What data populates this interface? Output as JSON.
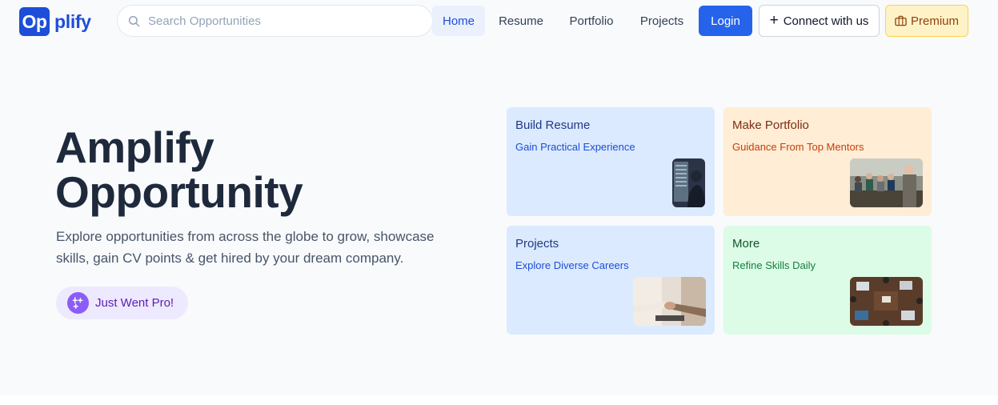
{
  "header": {
    "logo": {
      "box_text": "Op",
      "rest_text": "plify"
    },
    "search": {
      "placeholder": "Search Opportunities",
      "value": ""
    },
    "nav": [
      {
        "label": "Home",
        "active": true
      },
      {
        "label": "Resume",
        "active": false
      },
      {
        "label": "Portfolio",
        "active": false
      },
      {
        "label": "Projects",
        "active": false
      }
    ],
    "login_label": "Login",
    "connect_label": "Connect with us",
    "premium_label": "Premium"
  },
  "hero": {
    "title_line1": "Amplify",
    "title_line2": "Opportunity",
    "description": "Explore opportunities from across the globe to grow, showcase skills, gain CV points & get hired by your dream company.",
    "pro_badge_label": "Just Went Pro!"
  },
  "cards": [
    {
      "title": "Build Resume",
      "subtitle": "Gain Practical Experience",
      "image": "developer-at-monitors-photo"
    },
    {
      "title": "Make Portfolio",
      "subtitle": "Guidance From Top Mentors",
      "image": "team-meeting-photo"
    },
    {
      "title": "Projects",
      "subtitle": "Explore Diverse Careers",
      "image": "handshake-photo"
    },
    {
      "title": "More",
      "subtitle": "Refine Skills Daily",
      "image": "desk-with-laptops-photo"
    }
  ],
  "colors": {
    "brand": "#1d4ed8",
    "login_bg": "#2563eb",
    "premium_bg": "#fef3c7",
    "hero_bg": "#f8fafc",
    "card_blue": "#dbeafe",
    "card_orange": "#ffedd5",
    "card_green": "#dcfce7",
    "badge_bg": "#ede9fe"
  },
  "icons": [
    "search-icon",
    "plus-icon",
    "briefcase-icon",
    "sparkle-icon"
  ]
}
